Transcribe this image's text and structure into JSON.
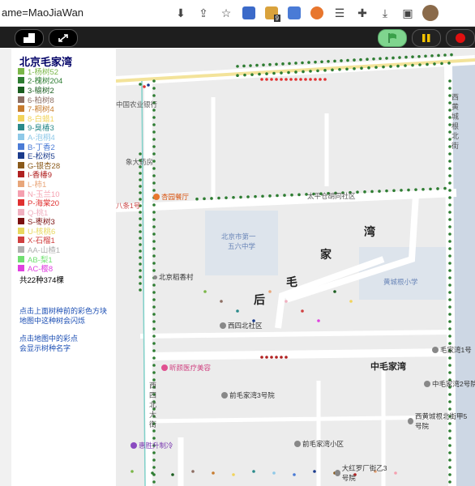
{
  "browser": {
    "url_text": "ame=MaoJiaWan",
    "ext_badge": "9"
  },
  "panel": {
    "title": "北京毛家湾",
    "legend": [
      {
        "label": "1-杨树52",
        "color": "#7ab648"
      },
      {
        "label": "2-槐树204",
        "color": "#2e7d32"
      },
      {
        "label": "3-榆树2",
        "color": "#1b5e20"
      },
      {
        "label": "6-柏树8",
        "color": "#8d6e63"
      },
      {
        "label": "7-桐树4",
        "color": "#c77c2e"
      },
      {
        "label": "8-白蜡1",
        "color": "#f2d45c"
      },
      {
        "label": "9-臭椿3",
        "color": "#2a8a8a"
      },
      {
        "label": "A-泡桐4",
        "color": "#8ec9e8"
      },
      {
        "label": "B-丁香2",
        "color": "#4a7bd6"
      },
      {
        "label": "E-松树5",
        "color": "#1a3b8c"
      },
      {
        "label": "G-银杏28",
        "color": "#8a5a1a"
      },
      {
        "label": "I-香椿9",
        "color": "#b02020"
      },
      {
        "label": "L-柿1",
        "color": "#e8a67a"
      },
      {
        "label": "N-玉兰10",
        "color": "#f5a0b0"
      },
      {
        "label": "P-海棠20",
        "color": "#e03030"
      },
      {
        "label": "Q-桃1",
        "color": "#f0b0c0"
      },
      {
        "label": "S-枣树3",
        "color": "#7a1010"
      },
      {
        "label": "U-核桃6",
        "color": "#e8d860"
      },
      {
        "label": "X-石榴1",
        "color": "#d04040"
      },
      {
        "label": "AA-山楂1",
        "color": "#b0b0b0"
      },
      {
        "label": "AB-梨1",
        "color": "#70e070"
      },
      {
        "label": "AC-樱8",
        "color": "#e040e0"
      }
    ],
    "total": "共22种374棵",
    "help1": "点击上面树种前的彩色方块",
    "help2": "地图中这种树会闪烁",
    "help3": "点击地图中的彩点",
    "help4": "会显示树种名字"
  },
  "map": {
    "labels": {
      "bank": "中国农业银行",
      "pharmacy": "象大药房",
      "restaurant": "杏园餐厅",
      "lane8": "八条1号",
      "taiping": "太平仓胡同社区",
      "school56_1": "北京市第一",
      "school56_2": "五六中学",
      "daoxiang": "北京稻香村",
      "huangcheng_school": "黄城根小学",
      "xisi": "西四北社区",
      "xinyan": "昕颜医疗美容",
      "maojiawan1": "毛家湾1号",
      "maojiawan2": "中毛家湾2号院",
      "maojiawan3": "前毛家湾3号院",
      "xihuangcheng_n": "西黄城根北街甲5号院",
      "qianmao": "前毛家湾小区",
      "huisheng": "惠胜升制冷",
      "dahongluo": "大红罗厂街乙3号院",
      "street_zhong": "中毛家湾",
      "hou": "后",
      "mao": "毛",
      "jia": "家",
      "wan": "湾",
      "xihuangchenggen": "西黄城根北街",
      "xisibei": "西四北大街"
    }
  }
}
